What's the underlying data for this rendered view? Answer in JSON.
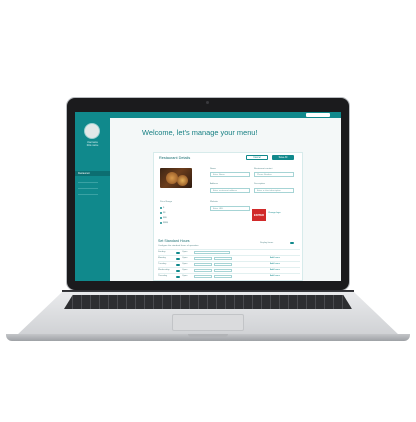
{
  "welcome_title": "Welcome, let's manage your menu!",
  "sidebar": {
    "user_line1": "Username",
    "user_line2": "Role name",
    "active_item": "Restaurant"
  },
  "card": {
    "title": "Restaurant Details",
    "cancel_label": "Cancel",
    "save_label": "Save All",
    "name_label": "Name",
    "name_placeholder": "Enter Name",
    "contact_label": "Restaurant contact",
    "contact_placeholder": "Phone Number",
    "address_label": "Address",
    "address_placeholder": "Enter restaurant address",
    "desc_label": "Description",
    "desc_placeholder": "Enter a short description",
    "website_label": "Website",
    "website_placeholder": "Enter URL",
    "logo_text": "EDITED",
    "logo_caption": "Change logo",
    "price_label": "Price Range",
    "price_options": [
      "$",
      "$$",
      "$$$",
      "$$$$"
    ]
  },
  "hours": {
    "title": "Set Standard Hours",
    "subtitle": "Configure the standard hours of operation",
    "toggle_label": "Display hours",
    "days": [
      "Sunday",
      "Monday",
      "Tuesday",
      "Wednesday",
      "Thursday"
    ],
    "status": "Open",
    "add_label": "Add hours"
  },
  "colors": {
    "accent": "#10898c",
    "logo": "#d12a2a"
  }
}
